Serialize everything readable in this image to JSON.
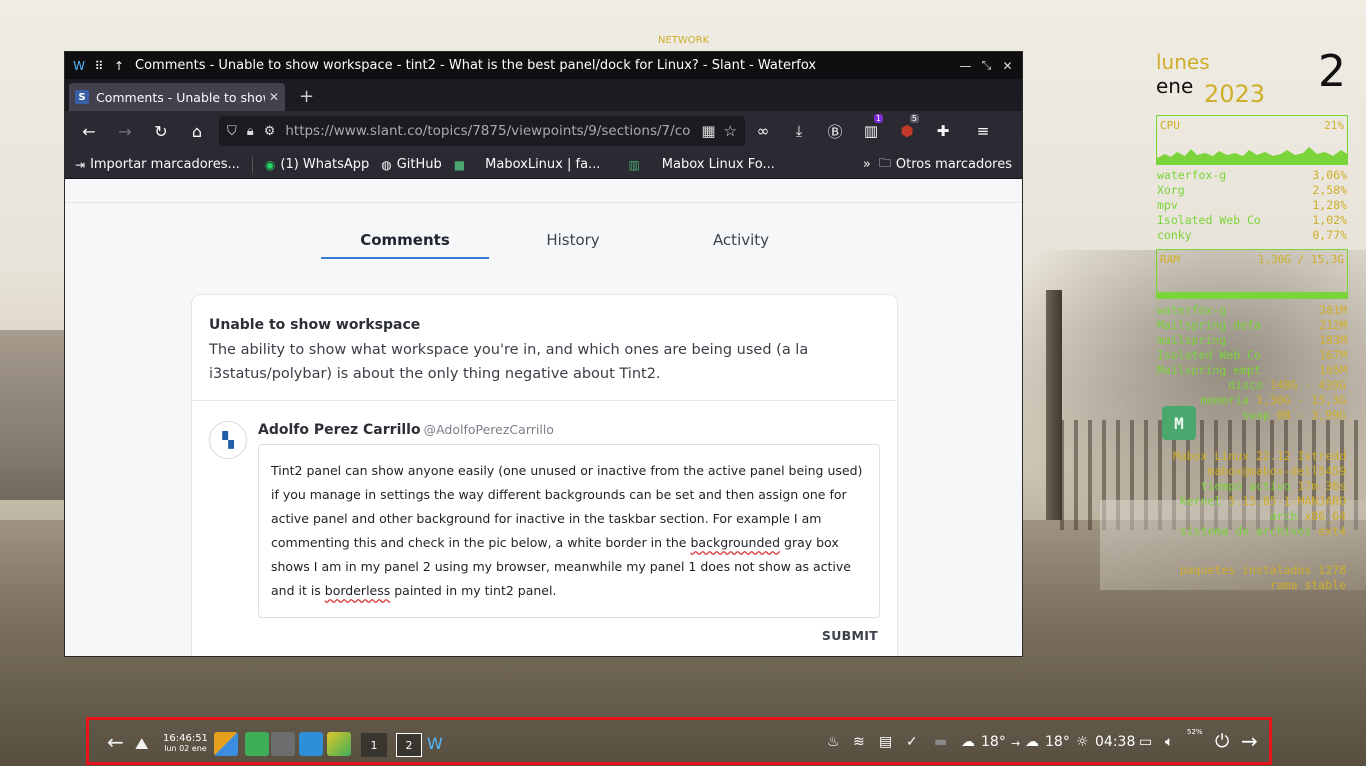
{
  "desktop": {
    "network_label": "NETWORK"
  },
  "window": {
    "title": "Comments - Unable to show workspace - tint2 - What is the best panel/dock for Linux? - Slant - Waterfox",
    "tab_label": "Comments - Unable to show",
    "tab_favicon": "S",
    "url": "https://www.slant.co/topics/7875/viewpoints/9/sections/7/co",
    "extension_badges": {
      "toolbar_icon": "1",
      "ublock": "5"
    },
    "bookmarks": {
      "import": "Importar marcadores...",
      "whatsapp": "(1) WhatsApp",
      "github": "GitHub",
      "mabox_fb": "MaboxLinux | fa...",
      "mabox_forum": "Mabox Linux Fo...",
      "other": "Otros marcadores"
    }
  },
  "page": {
    "tabs": [
      "Comments",
      "History",
      "Activity"
    ],
    "active_tab": "Comments",
    "card_title": "Unable to show workspace",
    "card_desc": "The ability to show what workspace you're in, and which ones are being used (a la i3status/polybar) is about the only thing negative about Tint2.",
    "comment": {
      "author": "Adolfo Perez Carrillo",
      "handle": "@AdolfoPerezCarrillo",
      "text_1": "Tint2 panel can show anyone easily  (one unused or inactive from the active panel being used) if you manage in settings the way different backgrounds can be set and then assign one for active panel and other background for inactive in the taskbar section. For example I am commenting this and check in the pic below,  a white border in the ",
      "text_sp1": "backgrounded",
      "text_2": " gray box shows I am in my panel 2 using my browser, meanwhile my panel 1 does not show as active and it is ",
      "text_sp2": "borderless",
      "text_3": " painted in my tint2 panel.",
      "submit": "SUBMIT"
    }
  },
  "conky": {
    "day": "lunes",
    "month": "ene",
    "year": "2023",
    "date": "2",
    "cpu_label": "CPU",
    "cpu_value": "21%",
    "cpu_procs": [
      {
        "name": "waterfox-g",
        "value": "3,06%"
      },
      {
        "name": "Xorg",
        "value": "2,58%"
      },
      {
        "name": "mpv",
        "value": "1,28%"
      },
      {
        "name": "Isolated Web Co",
        "value": "1,02%"
      },
      {
        "name": "conky",
        "value": "0,77%"
      }
    ],
    "ram_label": "RAM",
    "ram_value": "1,30G / 15,3G",
    "mem_procs": [
      {
        "name": "waterfox-g",
        "value": "381M"
      },
      {
        "name": "Mailspring defa",
        "value": "212M"
      },
      {
        "name": "mailspring",
        "value": "183M"
      },
      {
        "name": "Isolated Web Co",
        "value": "167M"
      },
      {
        "name": "Mailspring empt",
        "value": "165M"
      }
    ],
    "disk_label": "disco",
    "disk_value": "148G - 439G",
    "mem_label": "memoria",
    "mem_value": "1,30G - 15,3G",
    "swap_label": "swap",
    "swap_value": "0B - 3,99G",
    "distro": "Mabox Linux 22.12 Istredd",
    "host": "mabox@mabox-dell5459",
    "uptime_label": "tiempo activo",
    "uptime": "17m 36s",
    "kernel_label": "kernel",
    "kernel": "5.15.85-1-MANJARO",
    "arch_label": "arch",
    "arch": "x86_64",
    "fs_label": "sistema de archivos",
    "fs": "ext4",
    "pkgs_label": "paquetes instalados",
    "pkgs": "1278",
    "branch_label": "rama",
    "branch": "stable"
  },
  "taskbar": {
    "time": "16:46:51",
    "date": "lun 02 ene",
    "workspaces": [
      "1",
      "2"
    ],
    "active_workspace": "2",
    "weather_now": "18°",
    "weather_next": "18°",
    "sunset": "04:38",
    "volume": "52%"
  }
}
